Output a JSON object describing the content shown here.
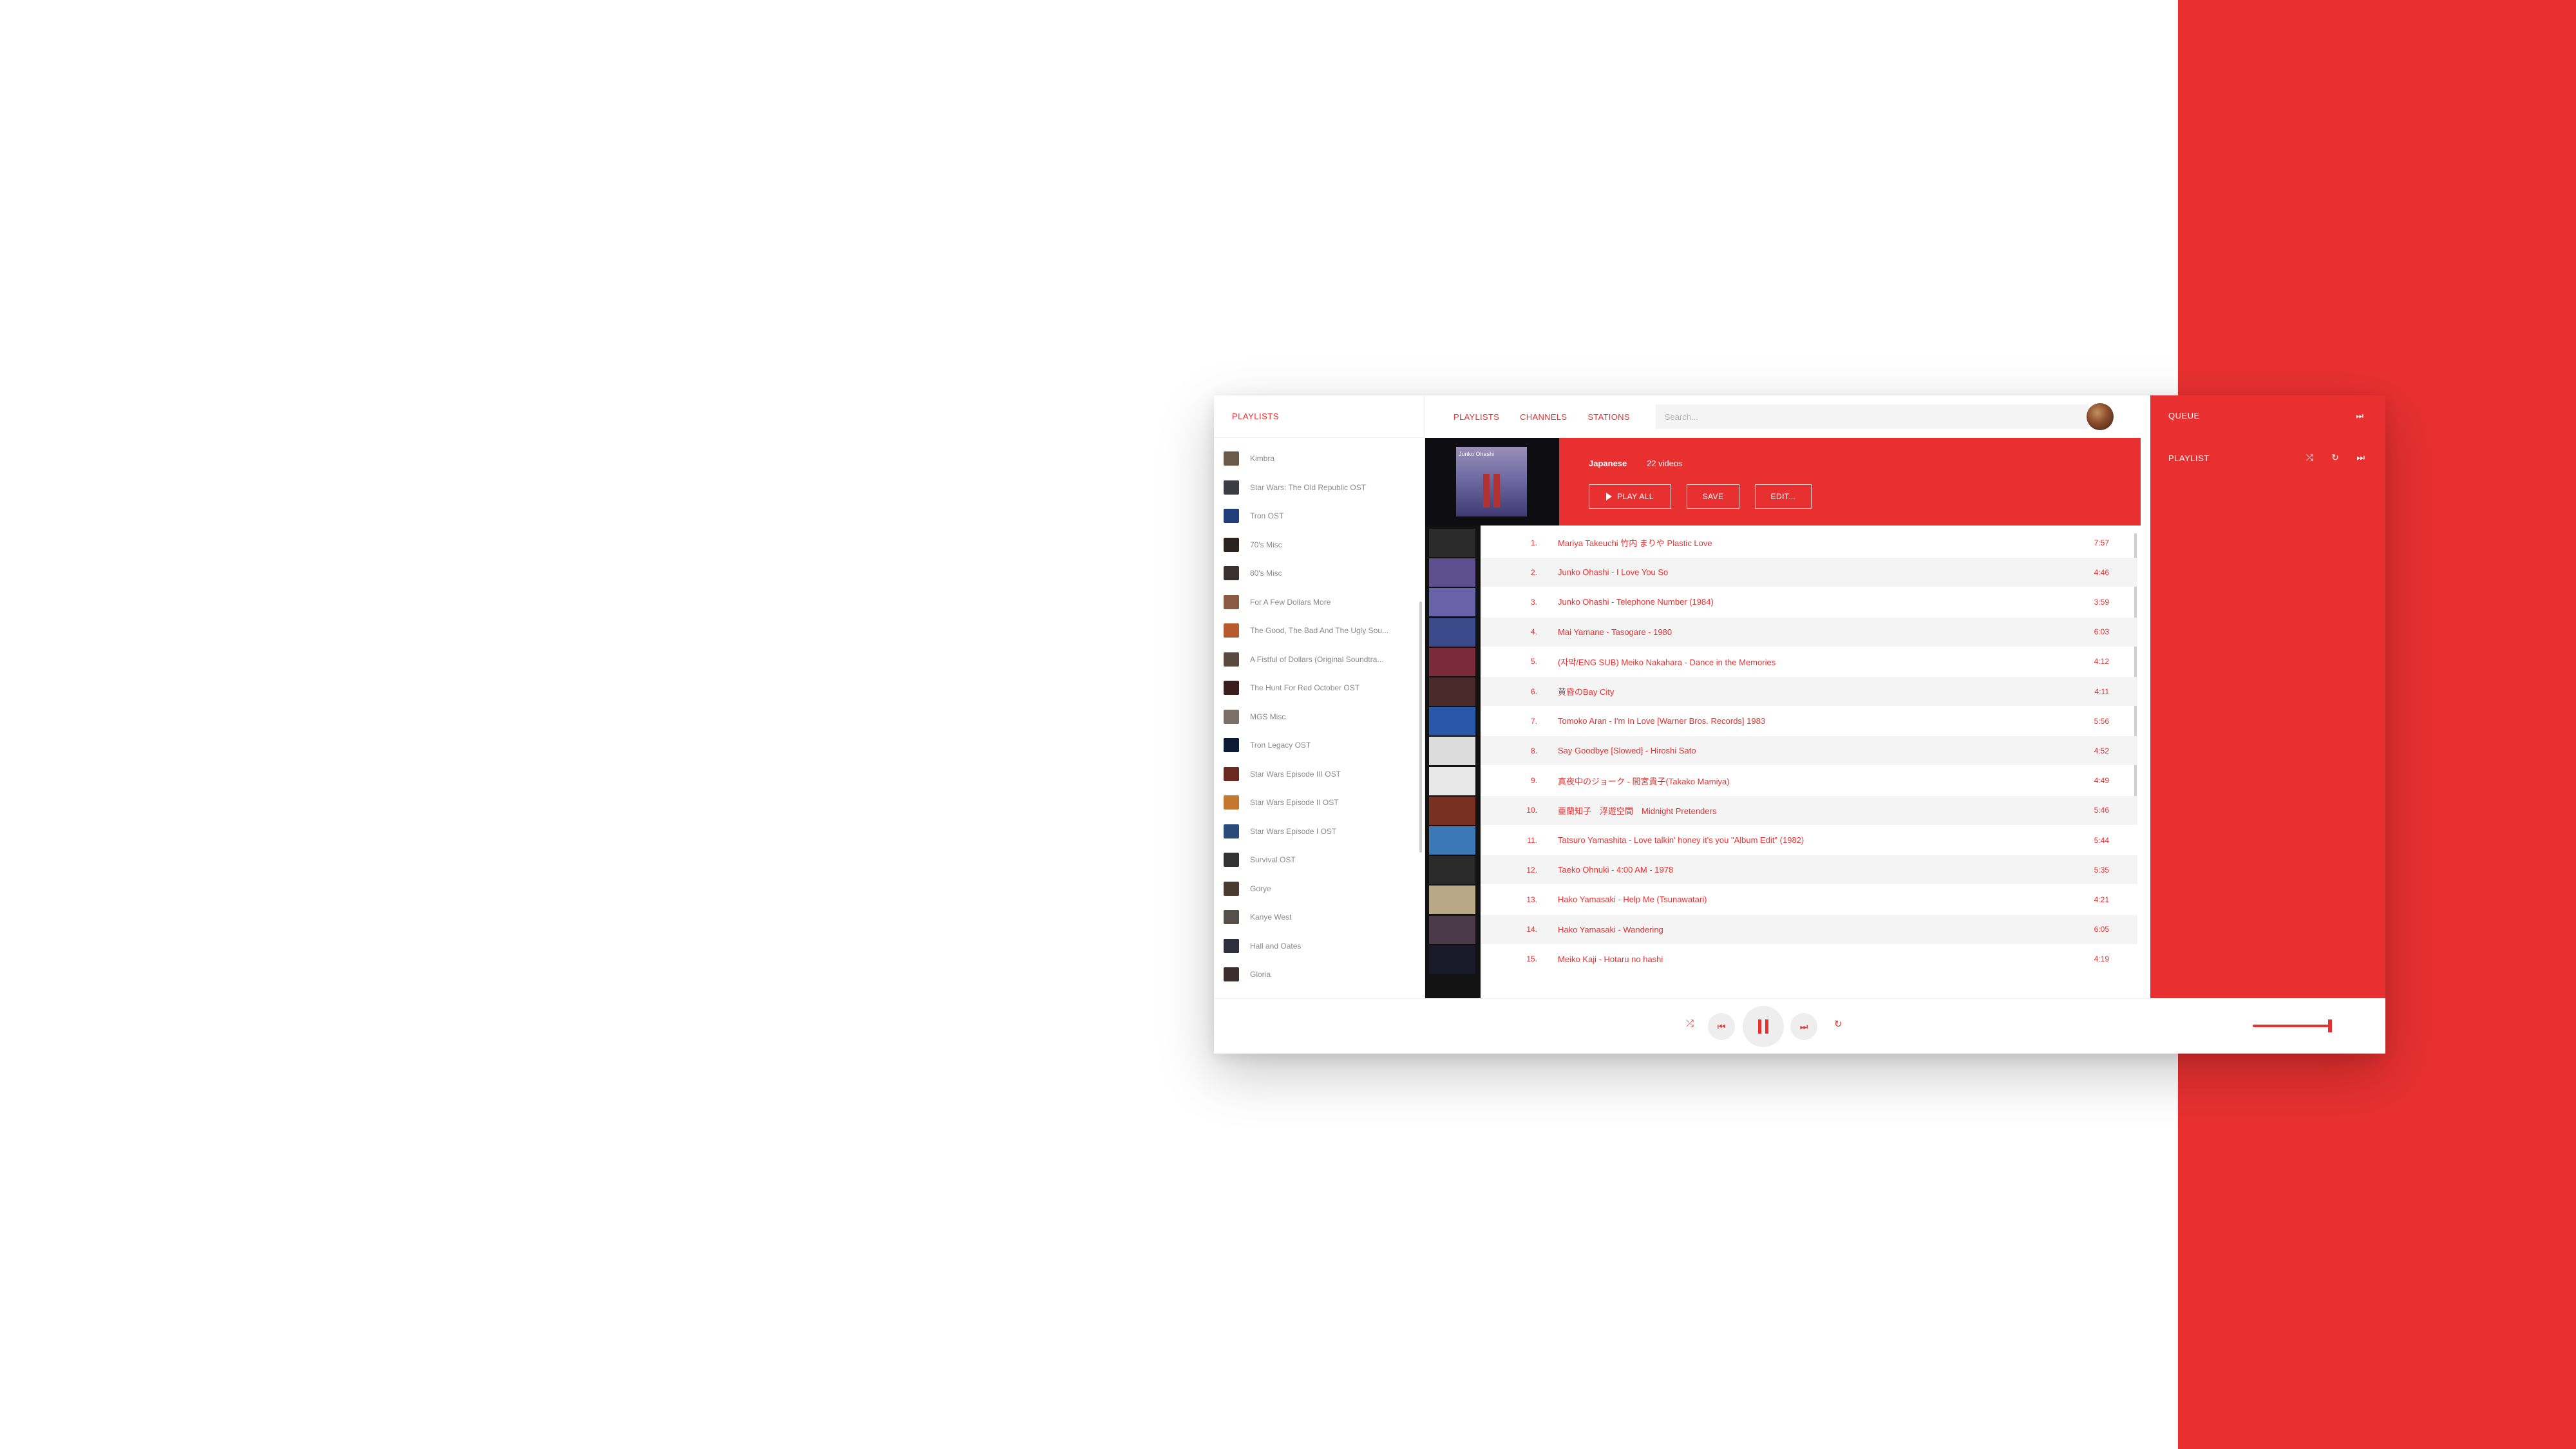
{
  "colors": {
    "accent": "#e83030",
    "text_muted": "#8a8a8a",
    "row_alt": "#f4f4f4"
  },
  "sidebar": {
    "title": "PLAYLISTS",
    "items": [
      {
        "label": "Kimbra",
        "thumb": "#6b5a48"
      },
      {
        "label": "Star Wars: The Old Republic OST",
        "thumb": "#3b3c44"
      },
      {
        "label": "Tron OST",
        "thumb": "#1f3e7a"
      },
      {
        "label": "70's Misc",
        "thumb": "#2a2320"
      },
      {
        "label": "80's Misc",
        "thumb": "#3a3030"
      },
      {
        "label": "For A Few Dollars More",
        "thumb": "#8a5a42"
      },
      {
        "label": "The Good, The Bad And The Ugly Sou...",
        "thumb": "#b85a2e"
      },
      {
        "label": "A Fistful of Dollars (Original Soundtra...",
        "thumb": "#5a4a3e"
      },
      {
        "label": "The Hunt For Red October OST",
        "thumb": "#3a1e1e"
      },
      {
        "label": "MGS Misc",
        "thumb": "#7a7068"
      },
      {
        "label": "Tron Legacy OST",
        "thumb": "#0d1a33"
      },
      {
        "label": "Star Wars Episode III OST",
        "thumb": "#6a2a20"
      },
      {
        "label": "Star Wars Episode II OST",
        "thumb": "#c2782e"
      },
      {
        "label": "Star Wars Episode I OST",
        "thumb": "#2a4a7a"
      },
      {
        "label": "Survival OST",
        "thumb": "#333333"
      },
      {
        "label": "Gorye",
        "thumb": "#4a3a30"
      },
      {
        "label": "Kanye West",
        "thumb": "#55504a"
      },
      {
        "label": "Hall and Oates",
        "thumb": "#2e2e3e"
      },
      {
        "label": "Gloria",
        "thumb": "#3a2e2e"
      }
    ]
  },
  "nav": {
    "tabs": [
      "PLAYLISTS",
      "CHANNELS",
      "STATIONS"
    ],
    "search_placeholder": "Search..."
  },
  "playlist": {
    "cover_title": "Junko Ohashi",
    "name": "Japanese",
    "count": "22 videos",
    "play_all": "PLAY ALL",
    "save": "SAVE",
    "edit": "EDIT..."
  },
  "tracks": [
    {
      "num": "1.",
      "title": "Mariya Takeuchi 竹内 まりや Plastic Love",
      "dur": "7:57",
      "thumb": "#2b2b2b"
    },
    {
      "num": "2.",
      "title": "Junko Ohashi - I Love You So",
      "dur": "4:46",
      "thumb": "#5e4f8f"
    },
    {
      "num": "3.",
      "title": "Junko Ohashi - Telephone Number (1984)",
      "dur": "3:59",
      "thumb": "#6a62a8"
    },
    {
      "num": "4.",
      "title": "Mai Yamane - Tasogare - 1980",
      "dur": "6:03",
      "thumb": "#3a4a8a"
    },
    {
      "num": "5.",
      "title": "(자막/ENG SUB) Meiko Nakahara - Dance in the Memories",
      "dur": "4:12",
      "thumb": "#7a2a3a"
    },
    {
      "num": "6.",
      "title": "黄昏のBay City",
      "dur": "4:11",
      "thumb": "#4a2a2a"
    },
    {
      "num": "7.",
      "title": "Tomoko Aran - I'm In Love [Warner Bros. Records] 1983",
      "dur": "5:56",
      "thumb": "#2a58a8"
    },
    {
      "num": "8.",
      "title": "Say Goodbye [Slowed] - Hiroshi Sato",
      "dur": "4:52",
      "thumb": "#dcdcdc"
    },
    {
      "num": "9.",
      "title": "真夜中のジョーク - 間宮貴子(Takako Mamiya)",
      "dur": "4:49",
      "thumb": "#e8e8e8"
    },
    {
      "num": "10.",
      "title": "亜蘭知子　浮遊空間　Midnight Pretenders",
      "dur": "5:46",
      "thumb": "#7a3020"
    },
    {
      "num": "11.",
      "title": "Tatsuro Yamashita - Love talkin' honey it's you \"Album Edit\" (1982)",
      "dur": "5:44",
      "thumb": "#3a78b8"
    },
    {
      "num": "12.",
      "title": "Taeko Ohnuki - 4:00 AM - 1978",
      "dur": "5:35",
      "thumb": "#2a2a2a"
    },
    {
      "num": "13.",
      "title": "Hako Yamasaki - Help Me (Tsunawatari)",
      "dur": "4:21",
      "thumb": "#b8a888"
    },
    {
      "num": "14.",
      "title": "Hako Yamasaki - Wandering",
      "dur": "6:05",
      "thumb": "#4a3a4a"
    },
    {
      "num": "15.",
      "title": "Meiko Kaji - Hotaru no hashi",
      "dur": "4:19",
      "thumb": "#1a1a2a"
    }
  ],
  "queue": {
    "title": "QUEUE",
    "subtitle": "PLAYLIST",
    "next_icon": "⏭",
    "shuffle_icon": "⤮",
    "repeat_icon": "↻"
  },
  "player": {
    "shuffle_icon": "⤮",
    "prev_icon": "⏮",
    "next_icon": "⏭",
    "repeat_icon": "↻",
    "volume": 0.95
  }
}
